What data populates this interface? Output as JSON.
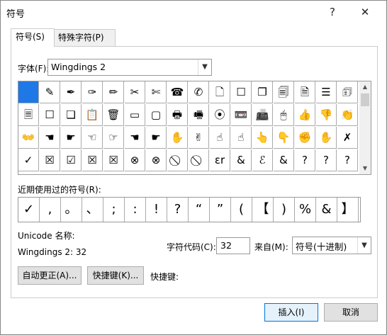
{
  "window": {
    "title": "符号",
    "help_label": "?",
    "close_label": "✕"
  },
  "tabs": [
    {
      "label": "符号(S)"
    },
    {
      "label": "特殊字符(P)"
    }
  ],
  "font": {
    "label": "字体(F):",
    "value": "Wingdings 2"
  },
  "symbols": [
    "",
    "✎",
    "✒",
    "✑",
    "✏",
    "✂",
    "✄",
    "☎",
    "✆",
    "🗋",
    "☐",
    "❐",
    "🗐",
    "🗎",
    "☰",
    "🗊",
    "🗏",
    "☐",
    "❏",
    "📋",
    "🗑",
    "▭",
    "▢",
    "🖶",
    "🖷",
    "⦿",
    "📼",
    "📠",
    "🖱",
    "👍",
    "👎",
    "👏",
    "👐",
    "☚",
    "☛",
    "☜",
    "☞",
    "☚",
    "☛",
    "✋",
    "✌",
    "☝",
    "☝",
    "👆",
    "👇",
    "✊",
    "✋",
    "✗",
    "✓",
    "☒",
    "☑",
    "☒",
    "☒",
    "⊗",
    "⊗",
    "⃠",
    "⃠",
    "ɛr",
    "&",
    "ℰ",
    "&",
    "?",
    "?",
    "?"
  ],
  "recent": {
    "label": "近期使用过的符号(R):",
    "items": [
      "✓",
      ",",
      "。",
      "、",
      ";",
      ":",
      "!",
      "?",
      "“",
      "”",
      "(",
      "【",
      ")",
      "%",
      "&",
      "】"
    ]
  },
  "unicode_name": {
    "label": "Unicode 名称:",
    "value": "Wingdings 2: 32"
  },
  "char_code": {
    "label": "字符代码(C):",
    "value": "32"
  },
  "from": {
    "label": "来自(M):",
    "value": "符号(十进制)"
  },
  "buttons": {
    "autocorrect": "自动更正(A)...",
    "shortcut_key": "快捷键(K)...",
    "shortcut_label": "快捷键:",
    "insert": "插入(I)",
    "cancel": "取消"
  }
}
